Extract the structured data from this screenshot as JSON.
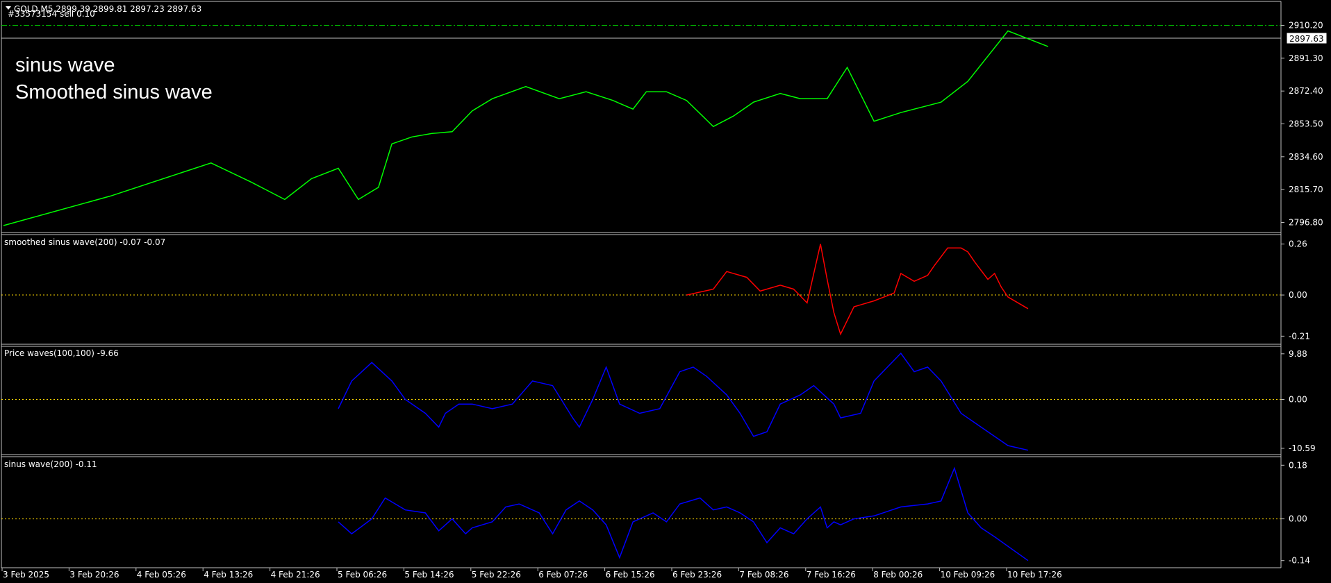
{
  "main": {
    "header": "GOLD,M5  2899.39 2899.81 2897.23 2897.63",
    "order": "#33573154 sell 0.10",
    "overlay_lines": [
      "sinus wave",
      "Smoothed sinus wave"
    ],
    "current_price": "2897.63",
    "order_price": 2910.2
  },
  "panes": {
    "smooth": {
      "label": "smoothed sinus wave(200) -0.07 -0.07"
    },
    "price": {
      "label": "Price waves(100,100) -9.66"
    },
    "sinus": {
      "label": "sinus wave(200) -0.11"
    }
  },
  "time_labels": [
    "3 Feb 2025",
    "3 Feb 20:26",
    "4 Feb 05:26",
    "4 Feb 13:26",
    "4 Feb 21:26",
    "5 Feb 06:26",
    "5 Feb 14:26",
    "5 Feb 22:26",
    "6 Feb 07:26",
    "6 Feb 15:26",
    "6 Feb 23:26",
    "7 Feb 08:26",
    "7 Feb 16:26",
    "8 Feb 00:26",
    "10 Feb 09:26",
    "10 Feb 17:26"
  ],
  "colors": {
    "background": "#000000",
    "price_line": "#00ff00",
    "smoothed_line": "#ff0000",
    "wave_line": "#0000ff",
    "zero_line": "#ffd700",
    "order_line": "#00c000",
    "axis": "#c0c0c0"
  },
  "chart_data": [
    {
      "type": "line",
      "name": "GOLD,M5",
      "y_ticks": [
        2910.2,
        2891.3,
        2872.4,
        2853.5,
        2834.6,
        2815.7,
        2796.8
      ],
      "ylim": [
        2793,
        2916
      ],
      "x": [
        0,
        1.6,
        3.1,
        3.7,
        4.2,
        4.6,
        5,
        5.3,
        5.6,
        5.8,
        6.1,
        6.4,
        6.7,
        7,
        7.3,
        7.8,
        8.3,
        8.7,
        9.1,
        9.4,
        9.6,
        9.9,
        10.2,
        10.6,
        10.9,
        11.2,
        11.6,
        11.9,
        12.3,
        12.6,
        13,
        13.4,
        14,
        14.4,
        15,
        15.6
      ],
      "values": [
        2795,
        2812,
        2831,
        2820,
        2810,
        2822,
        2828,
        2810,
        2817,
        2842,
        2846,
        2848,
        2849,
        2861,
        2868,
        2875,
        2868,
        2872,
        2867,
        2862,
        2872,
        2872,
        2867,
        2852,
        2858,
        2866,
        2871,
        2868,
        2868,
        2886,
        2855,
        2860,
        2866,
        2878,
        2907,
        2898
      ]
    },
    {
      "type": "line",
      "name": "smoothed sinus wave(200)",
      "y_ticks": [
        0.26,
        0.0,
        -0.21
      ],
      "ylim": [
        -0.23,
        0.28
      ],
      "x": [
        10.2,
        10.6,
        10.8,
        11.1,
        11.3,
        11.6,
        11.8,
        12,
        12.2,
        12.3,
        12.4,
        12.5,
        12.7,
        12.8,
        13,
        13.3,
        13.4,
        13.6,
        13.8,
        13.9,
        14.1,
        14.3,
        14.4,
        14.5,
        14.7,
        14.8,
        14.9,
        15,
        15.3
      ],
      "values": [
        0,
        0.03,
        0.12,
        0.09,
        0.02,
        0.05,
        0.03,
        -0.04,
        0.26,
        0.08,
        -0.09,
        -0.2,
        -0.06,
        -0.05,
        -0.03,
        0.01,
        0.11,
        0.07,
        0.1,
        0.15,
        0.24,
        0.24,
        0.22,
        0.17,
        0.08,
        0.11,
        0.04,
        -0.01,
        -0.07
      ]
    },
    {
      "type": "line",
      "name": "Price waves(100,100)",
      "y_ticks": [
        9.88,
        0.0,
        -10.59
      ],
      "ylim": [
        -11.2,
        10.3
      ],
      "x": [
        5,
        5.2,
        5.5,
        5.8,
        6,
        6.3,
        6.5,
        6.6,
        6.8,
        7,
        7.3,
        7.6,
        7.9,
        8.2,
        8.5,
        8.6,
        8.8,
        9,
        9.2,
        9.5,
        9.8,
        10.1,
        10.3,
        10.5,
        10.8,
        11,
        11.2,
        11.4,
        11.6,
        11.9,
        12.1,
        12.4,
        12.5,
        12.8,
        13,
        13.2,
        13.4,
        13.6,
        13.8,
        14,
        14.3,
        14.7,
        15,
        15.3
      ],
      "values": [
        -2,
        4,
        8,
        4,
        0,
        -3,
        -6,
        -3,
        -1,
        -1,
        -2,
        -1,
        4,
        3,
        -4,
        -6,
        0,
        7,
        -1,
        -3,
        -2,
        6,
        7,
        5,
        1,
        -3,
        -8,
        -7,
        -1,
        1,
        3,
        -1,
        -4,
        -3,
        4,
        7,
        10,
        6,
        7,
        4,
        -3,
        -7,
        -10,
        -11
      ]
    },
    {
      "type": "line",
      "name": "sinus wave(200)",
      "y_ticks": [
        0.18,
        0.0,
        -0.14
      ],
      "ylim": [
        -0.15,
        0.19
      ],
      "x": [
        5,
        5.2,
        5.5,
        5.7,
        6,
        6.3,
        6.5,
        6.7,
        6.9,
        7,
        7.3,
        7.5,
        7.7,
        8,
        8.2,
        8.4,
        8.6,
        8.8,
        9,
        9.2,
        9.4,
        9.7,
        9.9,
        10.1,
        10.4,
        10.6,
        10.8,
        11,
        11.2,
        11.4,
        11.6,
        11.8,
        12,
        12.2,
        12.3,
        12.4,
        12.5,
        12.7,
        13,
        13.4,
        13.8,
        14,
        14.2,
        14.4,
        14.6,
        14.8,
        15.3
      ],
      "values": [
        -0.01,
        -0.05,
        0,
        0.07,
        0.03,
        0.02,
        -0.04,
        0,
        -0.05,
        -0.03,
        -0.01,
        0.04,
        0.05,
        0.02,
        -0.05,
        0.03,
        0.06,
        0.03,
        -0.02,
        -0.13,
        -0.01,
        0.02,
        -0.01,
        0.05,
        0.07,
        0.03,
        0.04,
        0.02,
        -0.01,
        -0.08,
        -0.03,
        -0.05,
        0.0,
        0.04,
        -0.03,
        -0.01,
        -0.02,
        0.0,
        0.01,
        0.04,
        0.05,
        0.06,
        0.17,
        0.02,
        -0.03,
        -0.06,
        -0.14
      ]
    }
  ]
}
